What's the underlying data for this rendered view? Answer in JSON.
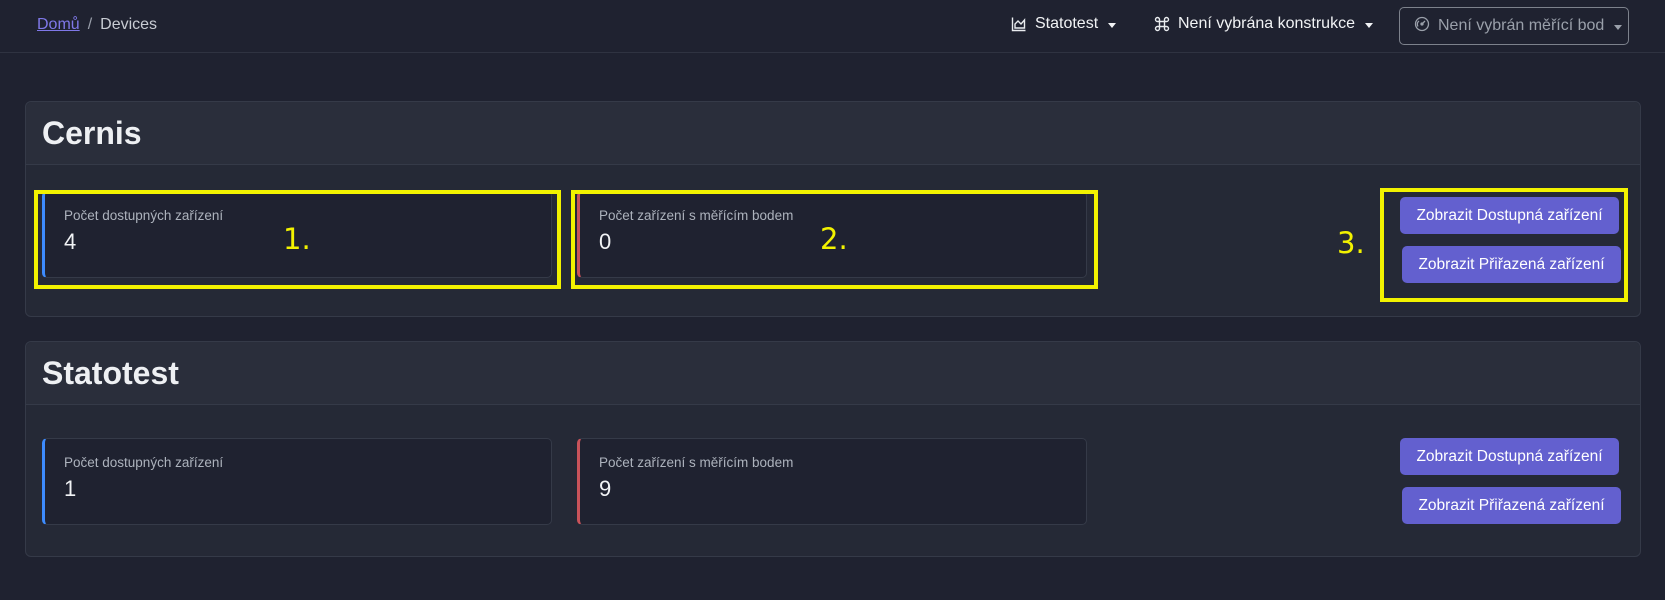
{
  "breadcrumb": {
    "home": "Domů",
    "separator": "/",
    "current": "Devices"
  },
  "nav": {
    "project": "Statotest",
    "construction": "Není vybrána konstrukce",
    "point": "Není vybrán měřící bod"
  },
  "sections": [
    {
      "title": "Cernis",
      "available_label": "Počet dostupných zařízení",
      "available_value": "4",
      "assigned_label": "Počet zařízení s měřícím bodem",
      "assigned_value": "0",
      "btn_available": "Zobrazit Dostupná zařízení",
      "btn_assigned": "Zobrazit Přiřazená zařízení"
    },
    {
      "title": "Statotest",
      "available_label": "Počet dostupných zařízení",
      "available_value": "1",
      "assigned_label": "Počet zařízení s měřícím bodem",
      "assigned_value": "9",
      "btn_available": "Zobrazit Dostupná zařízení",
      "btn_assigned": "Zobrazit Přiřazená zařízení"
    }
  ],
  "annotations": [
    "1.",
    "2.",
    "3."
  ],
  "colors": {
    "accent": "#6360cf",
    "available_border": "#3d8bfd",
    "assigned_border": "#c9535a",
    "highlight": "#f2f200"
  },
  "icons": {
    "project": "chart-area-icon",
    "construction": "command-icon",
    "point": "gauge-icon"
  }
}
